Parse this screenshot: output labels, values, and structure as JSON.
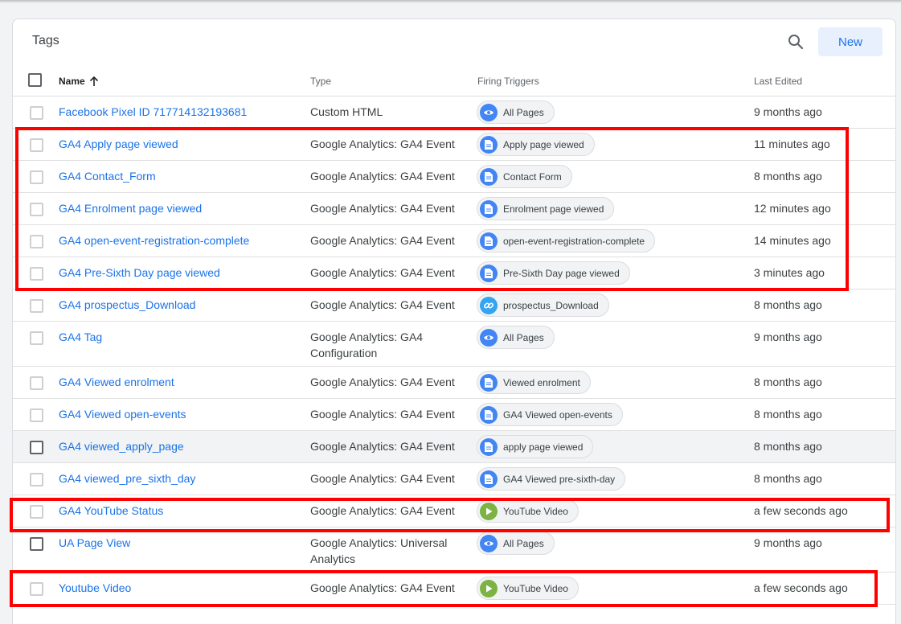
{
  "panel": {
    "title": "Tags",
    "new_label": "New"
  },
  "columns": {
    "name": "Name",
    "type": "Type",
    "triggers": "Firing Triggers",
    "last_edited": "Last Edited"
  },
  "rows": [
    {
      "name": "Facebook Pixel ID 717714132193681",
      "type": "Custom HTML",
      "trigger": "All Pages",
      "trigger_icon": "eye-icon",
      "last_edited": "9 months ago"
    },
    {
      "name": "GA4 Apply page viewed",
      "type": "Google Analytics: GA4 Event",
      "trigger": "Apply page viewed",
      "trigger_icon": "page-icon",
      "last_edited": "11 minutes ago"
    },
    {
      "name": "GA4 Contact_Form",
      "type": "Google Analytics: GA4 Event",
      "trigger": "Contact Form",
      "trigger_icon": "page-icon",
      "last_edited": "8 months ago"
    },
    {
      "name": "GA4 Enrolment page viewed",
      "type": "Google Analytics: GA4 Event",
      "trigger": "Enrolment page viewed",
      "trigger_icon": "page-icon",
      "last_edited": "12 minutes ago"
    },
    {
      "name": "GA4 open-event-registration-complete",
      "type": "Google Analytics: GA4 Event",
      "trigger": "open-event-registration-complete",
      "trigger_icon": "page-icon",
      "last_edited": "14 minutes ago"
    },
    {
      "name": "GA4 Pre-Sixth Day page viewed",
      "type": "Google Analytics: GA4 Event",
      "trigger": "Pre-Sixth Day page viewed",
      "trigger_icon": "page-icon",
      "last_edited": "3 minutes ago"
    },
    {
      "name": "GA4 prospectus_Download",
      "type": "Google Analytics: GA4 Event",
      "trigger": "prospectus_Download",
      "trigger_icon": "link-icon",
      "last_edited": "8 months ago"
    },
    {
      "name": "GA4 Tag",
      "type": "Google Analytics: GA4 Configuration",
      "trigger": "All Pages",
      "trigger_icon": "eye-icon",
      "last_edited": "9 months ago"
    },
    {
      "name": "GA4 Viewed enrolment",
      "type": "Google Analytics: GA4 Event",
      "trigger": "Viewed enrolment",
      "trigger_icon": "page-icon",
      "last_edited": "8 months ago"
    },
    {
      "name": "GA4 Viewed open-events",
      "type": "Google Analytics: GA4 Event",
      "trigger": "GA4 Viewed open-events",
      "trigger_icon": "page-icon",
      "last_edited": "8 months ago"
    },
    {
      "name": "GA4 viewed_apply_page",
      "type": "Google Analytics: GA4 Event",
      "trigger": "apply page viewed",
      "trigger_icon": "page-icon",
      "last_edited": "8 months ago"
    },
    {
      "name": "GA4 viewed_pre_sixth_day",
      "type": "Google Analytics: GA4 Event",
      "trigger": "GA4 Viewed pre-sixth-day",
      "trigger_icon": "page-icon",
      "last_edited": "8 months ago"
    },
    {
      "name": "GA4 YouTube Status",
      "type": "Google Analytics: GA4 Event",
      "trigger": "YouTube Video",
      "trigger_icon": "play-icon",
      "last_edited": "a few seconds ago"
    },
    {
      "name": "UA Page View",
      "type": "Google Analytics: Universal Analytics",
      "trigger": "All Pages",
      "trigger_icon": "eye-icon",
      "last_edited": "9 months ago"
    },
    {
      "name": "Youtube Video",
      "type": "Google Analytics: GA4 Event",
      "trigger": "YouTube Video",
      "trigger_icon": "play-icon",
      "last_edited": "a few seconds ago"
    }
  ]
}
